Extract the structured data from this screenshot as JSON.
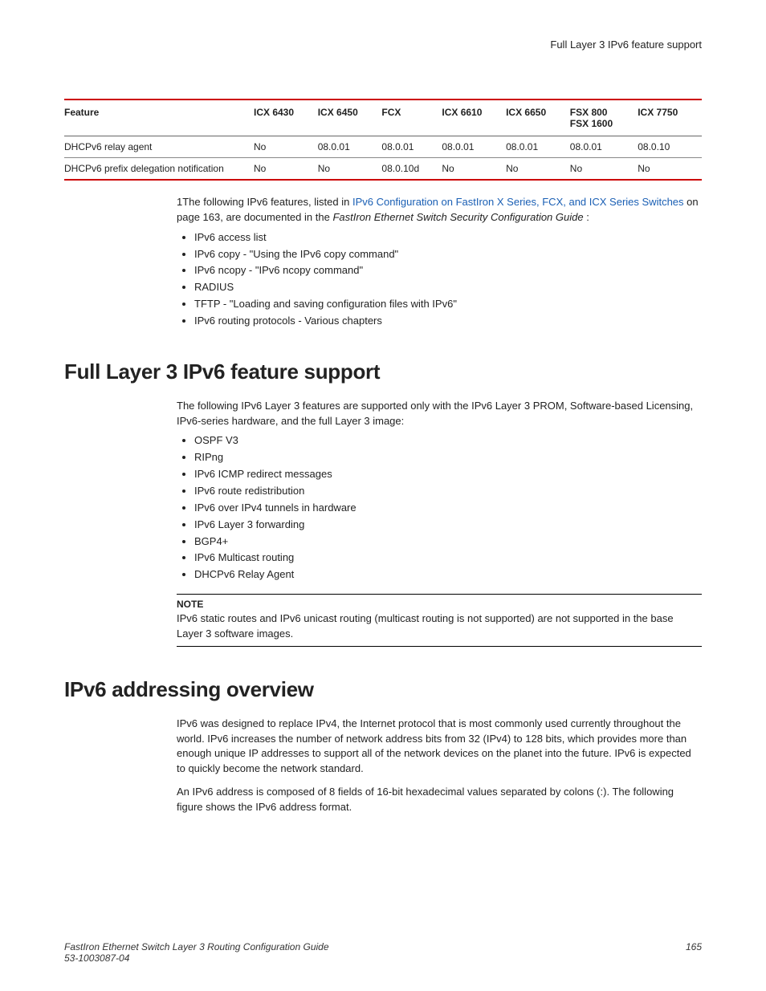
{
  "header": {
    "title": "Full Layer 3 IPv6 feature support"
  },
  "table": {
    "headers": {
      "c0": "Feature",
      "c1": "ICX 6430",
      "c2": "ICX 6450",
      "c3": "FCX",
      "c4": "ICX 6610",
      "c5": "ICX 6650",
      "c6a": "FSX 800",
      "c6b": "FSX 1600",
      "c7": "ICX 7750"
    },
    "rows": [
      {
        "c0": "DHCPv6 relay agent",
        "c1": "No",
        "c2": "08.0.01",
        "c3": "08.0.01",
        "c4": "08.0.01",
        "c5": "08.0.01",
        "c6": "08.0.01",
        "c7": "08.0.10"
      },
      {
        "c0": "DHCPv6 prefix delegation notification",
        "c1": "No",
        "c2": "No",
        "c3": "08.0.10d",
        "c4": "No",
        "c5": "No",
        "c6": "No",
        "c7": "No"
      }
    ]
  },
  "footnote": {
    "prefix": "1The following IPv6 features, listed in ",
    "link": "IPv6 Configuration on FastIron X Series, FCX, and ICX Series Switches",
    "mid": " on page 163, are documented in the ",
    "italic": "FastIron Ethernet Switch Security Configuration Guide",
    "suffix": " :"
  },
  "footnote_bullets": [
    "IPv6 access list",
    "IPv6 copy - \"Using the IPv6 copy command\"",
    "IPv6 ncopy - \"IPv6 ncopy command\"",
    "RADIUS",
    "TFTP - \"Loading and saving configuration files with IPv6\"",
    "IPv6 routing protocols - Various chapters"
  ],
  "section1": {
    "heading": "Full Layer 3 IPv6 feature support",
    "intro": "The following IPv6 Layer 3 features are supported only with the IPv6 Layer 3 PROM, Software-based Licensing, IPv6-series hardware, and the full Layer 3 image:",
    "bullets": [
      "OSPF V3",
      "RIPng",
      "IPv6 ICMP redirect messages",
      "IPv6 route redistribution",
      "IPv6 over IPv4 tunnels in hardware",
      "IPv6 Layer 3 forwarding",
      "BGP4+",
      "IPv6 Multicast routing",
      "DHCPv6 Relay Agent"
    ],
    "note_label": "NOTE",
    "note_text": "IPv6 static routes and IPv6 unicast routing (multicast routing is not supported) are not supported in the base Layer 3 software images."
  },
  "section2": {
    "heading": "IPv6 addressing overview",
    "p1": "IPv6 was designed to replace IPv4, the Internet protocol that is most commonly used currently throughout the world. IPv6 increases the number of network address bits from 32 (IPv4) to 128 bits, which provides more than enough unique IP addresses to support all of the network devices on the planet into the future. IPv6 is expected to quickly become the network standard.",
    "p2": "An IPv6 address is composed of 8 fields of 16-bit hexadecimal values separated by colons (:). The following figure shows the IPv6 address format."
  },
  "footer": {
    "title": "FastIron Ethernet Switch Layer 3 Routing Configuration Guide",
    "docnum": "53-1003087-04",
    "page": "165"
  }
}
